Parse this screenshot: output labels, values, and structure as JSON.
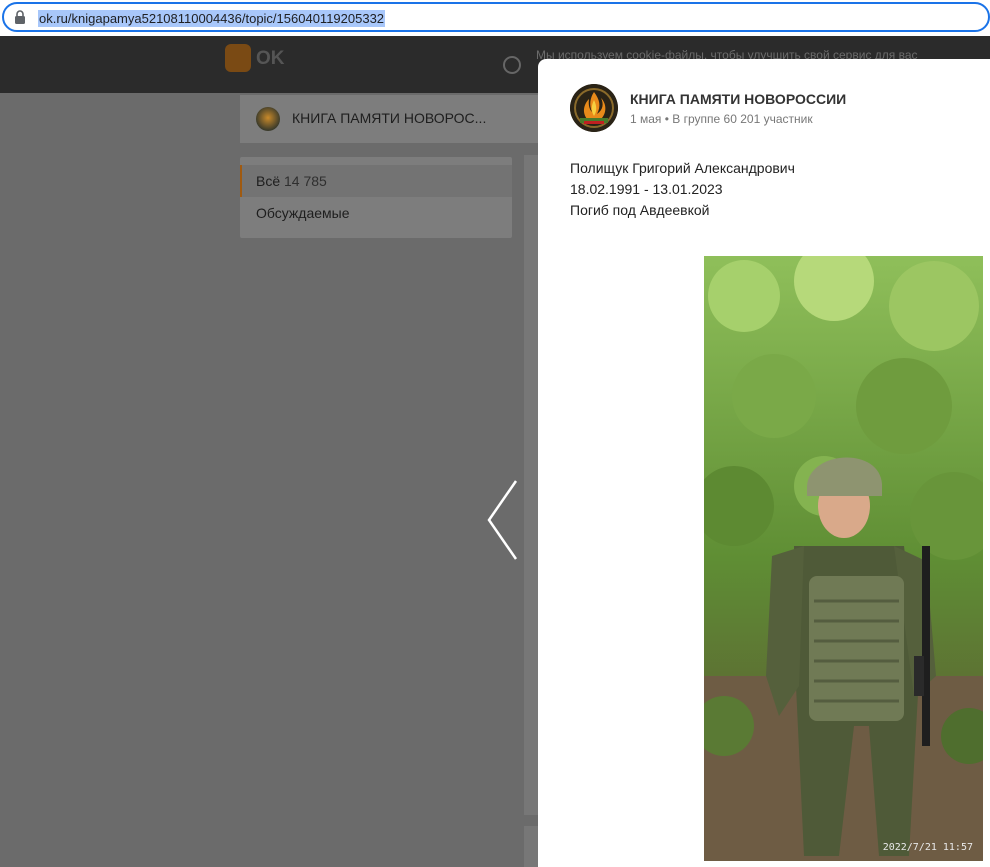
{
  "browser": {
    "url": "ok.ru/knigapamya52108110004436/topic/156040119205332"
  },
  "site": {
    "logo_text": "OK",
    "cookie_notice": "Мы используем cookie-файлы, чтобы улучшить свой сервис для вас"
  },
  "group_header": {
    "name": "КНИГА ПАМЯТИ НОВОРОС..."
  },
  "filter": {
    "items": [
      {
        "label": "Всё",
        "count": "14 785"
      },
      {
        "label": "Обсуждаемые"
      }
    ]
  },
  "post": {
    "group_name": "КНИГА ПАМЯТИ НОВОРОССИИ",
    "meta": "1 мая • В группе 60 201 участник",
    "lines": [
      "Полищук Григорий Александрович",
      "18.02.1991 - 13.01.2023",
      "Погиб под Авдеевкой"
    ],
    "photo_timestamp": "2022/7/21 11:57"
  },
  "colors": {
    "accent": "#ee8208",
    "overlay": "#6b6b6b",
    "address_highlight": "#a8c7fa"
  }
}
